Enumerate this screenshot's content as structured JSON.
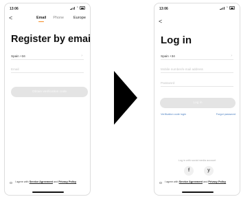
{
  "status_bar": {
    "time": "13:06"
  },
  "register": {
    "back_glyph": "<",
    "tabs": [
      "Email",
      "Phone"
    ],
    "active_tab": "Email",
    "region": "Europe",
    "title": "Register by email",
    "country_value": "Spain +34",
    "email_placeholder": "Email",
    "button_label": "Obtain verification code",
    "agreement": {
      "prefix": "I agree with ",
      "service": "Service Agreement",
      "and": " and ",
      "privacy": "Privacy Policy"
    }
  },
  "login": {
    "back_glyph": "<",
    "title": "Log in",
    "country_value": "Spain +34",
    "account_placeholder": "Mobile number/e-mail address",
    "password_placeholder": "Password",
    "button_label": "Log in",
    "verification_link": "Verification code login",
    "forgot_link": "Forgot password",
    "social_caption": "Log in with social media account",
    "social": [
      {
        "name": "facebook",
        "glyph": "f"
      },
      {
        "name": "twitter",
        "glyph": "y"
      }
    ],
    "agreement": {
      "prefix": "I agree with ",
      "service": "Service Agreement",
      "and": " and ",
      "privacy": "Privacy Policy"
    }
  },
  "icons": {
    "chevron": "chevron-right-icon",
    "arrow": "right-arrow-icon"
  },
  "colors": {
    "accent": "#f5891f",
    "link": "#4a7fc1",
    "button_disabled": "#e4e4e4"
  }
}
